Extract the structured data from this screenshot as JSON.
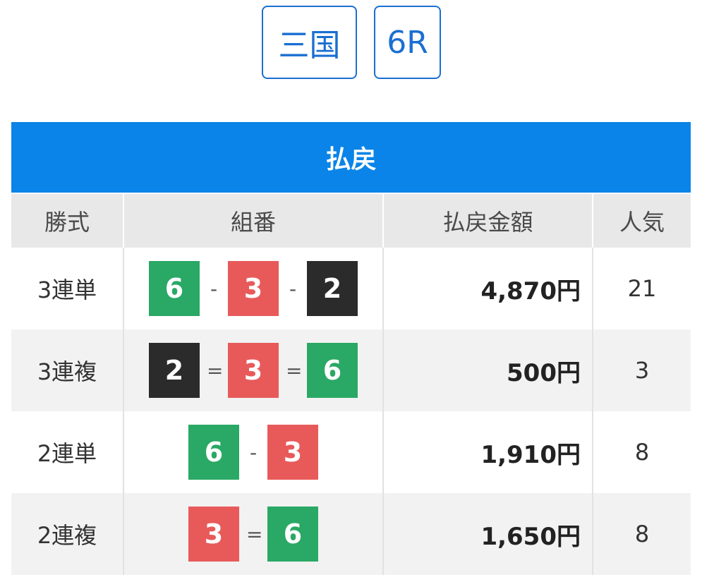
{
  "race": {
    "venue": "三国",
    "race_no": "6R"
  },
  "colors": {
    "1": "#f2f2f2",
    "2": "#2b2b2b",
    "3": "#e85a5a",
    "6": "#2aa865",
    "header_bg": "#0a84e8",
    "accent": "#1a6fd1"
  },
  "table": {
    "title": "払戻",
    "headers": [
      "勝式",
      "組番",
      "払戻金額",
      "人気"
    ],
    "rows": [
      {
        "type": "3連単",
        "combo": [
          "6",
          "3",
          "2"
        ],
        "sep": "-",
        "amount": "4,870円",
        "popularity": "21"
      },
      {
        "type": "3連複",
        "combo": [
          "2",
          "3",
          "6"
        ],
        "sep": "=",
        "amount": "500円",
        "popularity": "3"
      },
      {
        "type": "2連単",
        "combo": [
          "6",
          "3"
        ],
        "sep": "-",
        "amount": "1,910円",
        "popularity": "8"
      },
      {
        "type": "2連複",
        "combo": [
          "3",
          "6"
        ],
        "sep": "=",
        "amount": "1,650円",
        "popularity": "8"
      }
    ]
  }
}
